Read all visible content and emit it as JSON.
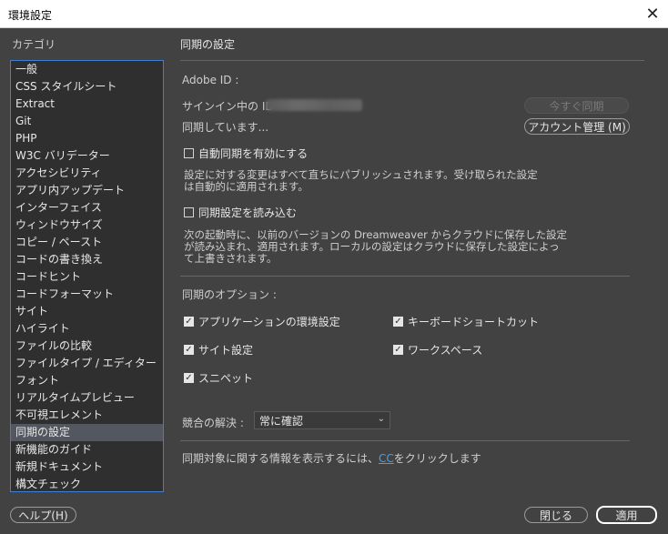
{
  "window": {
    "title": "環境設定",
    "close_glyph": "✕"
  },
  "categories": {
    "heading": "カテゴリ",
    "items": [
      "一般",
      "CSS スタイルシート",
      "Extract",
      "Git",
      "PHP",
      "W3C バリデーター",
      "アクセシビリティ",
      "アプリ内アップデート",
      "インターフェイス",
      "ウィンドウサイズ",
      "コピー / ペースト",
      "コードの書き換え",
      "コードヒント",
      "コードフォーマット",
      "サイト",
      "ハイライト",
      "ファイルの比較",
      "ファイルタイプ / エディター",
      "フォント",
      "リアルタイムプレビュー",
      "不可視エレメント",
      "同期の設定",
      "新機能のガイド",
      "新規ドキュメント",
      "構文チェック"
    ],
    "selected": "同期の設定"
  },
  "main": {
    "title": "同期の設定",
    "adobe_id_label": "Adobe ID :",
    "signed_in_label": "サインイン中の ID",
    "sync_now_button": "今すぐ同期",
    "syncing_status": "同期しています...",
    "manage_account_button": "アカウント管理 (M)",
    "auto_sync": {
      "label": "自動同期を有効にする",
      "checked": false,
      "description_line1": "設定に対する変更はすべて直ちにパブリッシュされます。受け取られた設定",
      "description_line2": "は自動的に適用されます。"
    },
    "import_sync": {
      "label": "同期設定を読み込む",
      "checked": false,
      "description_line1": "次の起動時に、以前のバージョンの Dreamweaver からクラウドに保存した設定",
      "description_line2": "が読み込まれ、適用されます。ローカルの設定はクラウドに保存した設定によっ",
      "description_line3": "て上書きされます。"
    },
    "sync_options_label": "同期のオプション :",
    "options": {
      "app_prefs": {
        "label": "アプリケーションの環境設定",
        "checked": true
      },
      "shortcuts": {
        "label": "キーボードショートカット",
        "checked": true
      },
      "site_settings": {
        "label": "サイト設定",
        "checked": true
      },
      "workspace": {
        "label": "ワークスペース",
        "checked": true
      },
      "snippets": {
        "label": "スニペット",
        "checked": true
      }
    },
    "conflict_label": "競合の解決 :",
    "conflict_value": "常に確認",
    "info_text_before": "同期対象に関する情報を表示するには、",
    "info_link": "CC",
    "info_text_after": "をクリックします"
  },
  "footer": {
    "help_button": "ヘルプ(H)",
    "close_button": "閉じる",
    "apply_button": "適用"
  }
}
